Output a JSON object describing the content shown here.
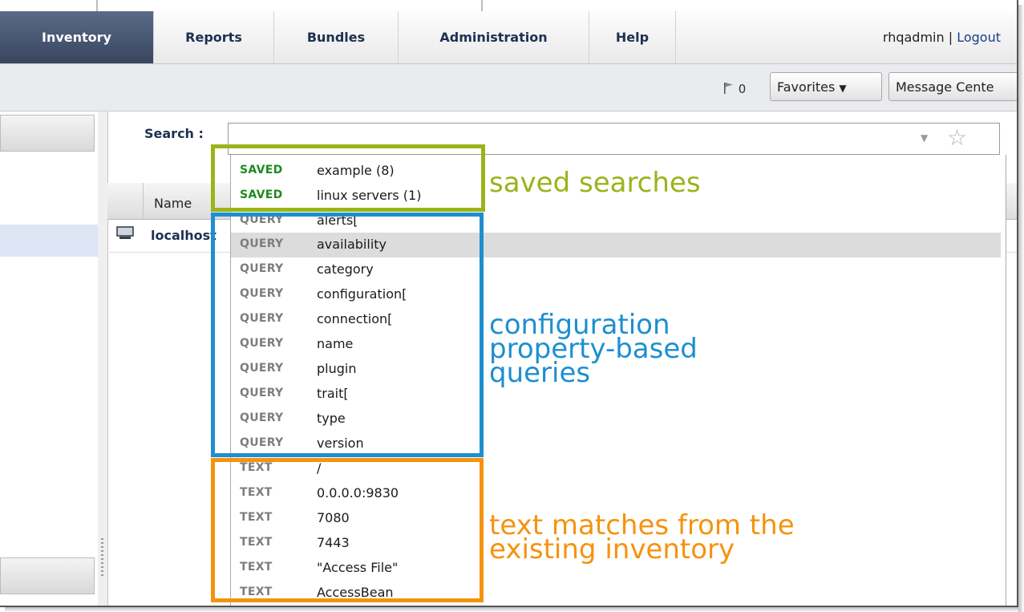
{
  "nav": {
    "tabs": [
      {
        "label": "Inventory",
        "active": true
      },
      {
        "label": "Reports",
        "active": false
      },
      {
        "label": "Bundles",
        "active": false
      },
      {
        "label": "Administration",
        "active": false
      },
      {
        "label": "Help",
        "active": false
      }
    ],
    "username": "rhqadmin",
    "separator": "|",
    "logout": "Logout"
  },
  "toolbar": {
    "flag_icon": "flag-icon",
    "flag_count": "0",
    "favorites_label": "Favorites",
    "message_center_label": "Message Cente"
  },
  "search": {
    "label": "Search :",
    "value": "",
    "dropdown_icon": "chevron-down-icon",
    "favorite_icon": "star-icon"
  },
  "table": {
    "column_name": "Name",
    "rows": [
      {
        "icon": "monitor-icon",
        "name": "localhost"
      }
    ]
  },
  "suggestions": [
    {
      "kind": "SAVED",
      "value": "example (8)"
    },
    {
      "kind": "SAVED",
      "value": "linux servers (1)"
    },
    {
      "kind": "QUERY",
      "value": "alerts["
    },
    {
      "kind": "QUERY",
      "value": "availability",
      "highlighted": true
    },
    {
      "kind": "QUERY",
      "value": "category"
    },
    {
      "kind": "QUERY",
      "value": "configuration["
    },
    {
      "kind": "QUERY",
      "value": "connection["
    },
    {
      "kind": "QUERY",
      "value": "name"
    },
    {
      "kind": "QUERY",
      "value": "plugin"
    },
    {
      "kind": "QUERY",
      "value": "trait["
    },
    {
      "kind": "QUERY",
      "value": "type"
    },
    {
      "kind": "QUERY",
      "value": "version"
    },
    {
      "kind": "TEXT",
      "value": "/"
    },
    {
      "kind": "TEXT",
      "value": "0.0.0.0:9830"
    },
    {
      "kind": "TEXT",
      "value": "7080"
    },
    {
      "kind": "TEXT",
      "value": "7443"
    },
    {
      "kind": "TEXT",
      "value": "\"Access File\""
    },
    {
      "kind": "TEXT",
      "value": "AccessBean"
    }
  ],
  "annotations": {
    "saved": "saved searches",
    "query": "configuration\nproperty-based\nqueries",
    "text": "text matches from the\nexisting inventory"
  },
  "colors": {
    "saved_green": "#9ab41a",
    "query_blue": "#1d8fd0",
    "text_orange": "#f5930f",
    "nav_active": "#4a5a78"
  }
}
